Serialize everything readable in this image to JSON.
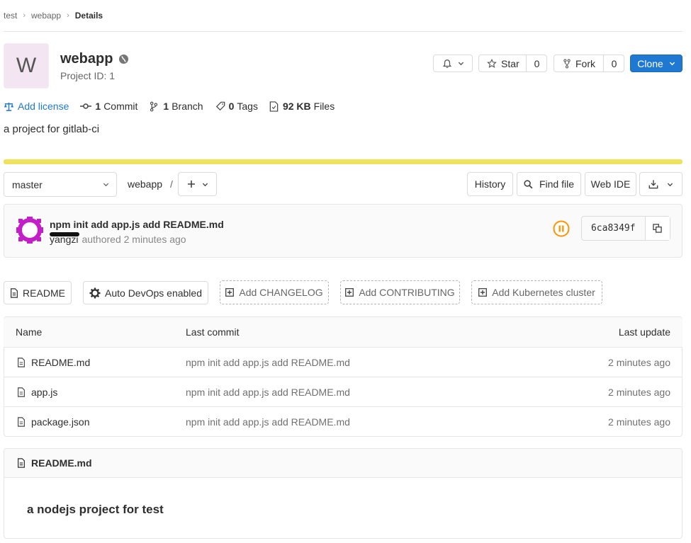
{
  "breadcrumb": [
    "test",
    "webapp",
    "Details"
  ],
  "project": {
    "avatar_letter": "W",
    "name": "webapp",
    "id_label": "Project ID: 1",
    "description": "a project for gitlab-ci"
  },
  "actions": {
    "star_label": "Star",
    "star_count": "0",
    "fork_label": "Fork",
    "fork_count": "0",
    "clone_label": "Clone"
  },
  "stats": {
    "add_license": "Add license",
    "commits_count": "1",
    "commits_label": "Commit",
    "branches_count": "1",
    "branches_label": "Branch",
    "tags_count": "0",
    "tags_label": "Tags",
    "files_size": "92 KB",
    "files_label": "Files"
  },
  "toolbar": {
    "branch": "master",
    "path": "webapp",
    "path_sep": "/",
    "history": "History",
    "find_file": "Find file",
    "web_ide": "Web IDE"
  },
  "commit": {
    "message": "npm init add app.js add README.md",
    "author": "yangzi",
    "authored": "authored 2 minutes ago",
    "sha": "6ca8349f"
  },
  "shortcuts": {
    "readme": "README",
    "auto_devops": "Auto DevOps enabled",
    "add_changelog": "Add CHANGELOG",
    "add_contributing": "Add CONTRIBUTING",
    "add_k8s": "Add Kubernetes cluster"
  },
  "file_table": {
    "headers": {
      "name": "Name",
      "last_commit": "Last commit",
      "last_update": "Last update"
    },
    "rows": [
      {
        "name": "README.md",
        "commit": "npm init add app.js add README.md",
        "updated": "2 minutes ago"
      },
      {
        "name": "app.js",
        "commit": "npm init add app.js add README.md",
        "updated": "2 minutes ago"
      },
      {
        "name": "package.json",
        "commit": "npm init add app.js add README.md",
        "updated": "2 minutes ago"
      }
    ]
  },
  "readme": {
    "file_title": "README.md",
    "content_heading": "a nodejs project for test"
  },
  "colors": {
    "primary_blue": "#1f78d1",
    "pipeline_orange": "#fc9403",
    "banner_yellow": "#f0e25a",
    "avatar_purple": "#c41ec8"
  }
}
